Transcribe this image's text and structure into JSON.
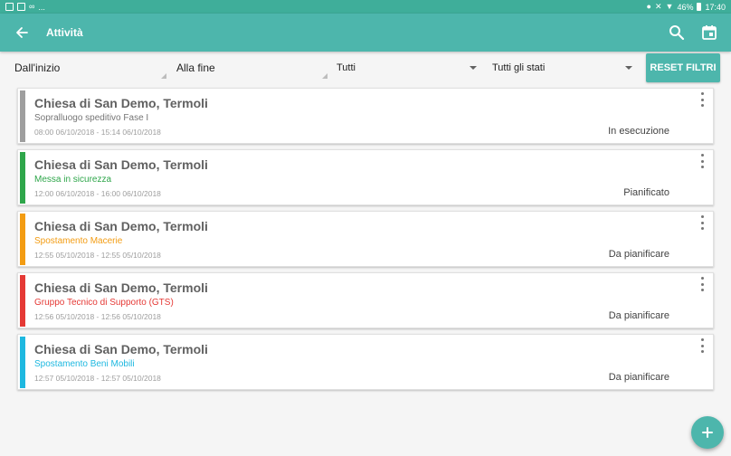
{
  "status_bar": {
    "left_text": "...",
    "battery": "46%",
    "time": "17:40"
  },
  "toolbar": {
    "title": "Attività",
    "icons": [
      "arrow-back-icon",
      "search-icon",
      "calendar-icon"
    ]
  },
  "filters": {
    "from": "Dall'inizio",
    "to": "Alla fine",
    "type": "Tutti",
    "status": "Tutti gli stati",
    "reset_label": "RESET FILTRI"
  },
  "colors": {
    "accent": "#4db6ac",
    "status_bar": "#3fae9a"
  },
  "cards": [
    {
      "title": "Chiesa di San Demo, Termoli",
      "subtitle": "Sopralluogo speditivo Fase I",
      "time": "08:00 06/10/2018 - 15:14 06/10/2018",
      "status": "In esecuzione",
      "color": "#9e9e9e",
      "subtitle_color": "#757575"
    },
    {
      "title": "Chiesa di San Demo, Termoli",
      "subtitle": "Messa in sicurezza",
      "time": "12:00 06/10/2018 - 16:00 06/10/2018",
      "status": "Pianificato",
      "color": "#2ea64a",
      "subtitle_color": "#2ea64a"
    },
    {
      "title": "Chiesa di San Demo, Termoli",
      "subtitle": "Spostamento Macerie",
      "time": "12:55 05/10/2018 - 12:55 05/10/2018",
      "status": "Da pianificare",
      "color": "#f39c12",
      "subtitle_color": "#f39c12"
    },
    {
      "title": "Chiesa di San Demo, Termoli",
      "subtitle": "Gruppo Tecnico di Supporto (GTS)",
      "time": "12:56 05/10/2018 - 12:56 05/10/2018",
      "status": "Da pianificare",
      "color": "#e53935",
      "subtitle_color": "#e53935"
    },
    {
      "title": "Chiesa di San Demo, Termoli",
      "subtitle": "Spostamento Beni Mobili",
      "time": "12:57 05/10/2018 - 12:57 05/10/2018",
      "status": "Da pianificare",
      "color": "#1eb8e0",
      "subtitle_color": "#1eb8e0"
    }
  ]
}
